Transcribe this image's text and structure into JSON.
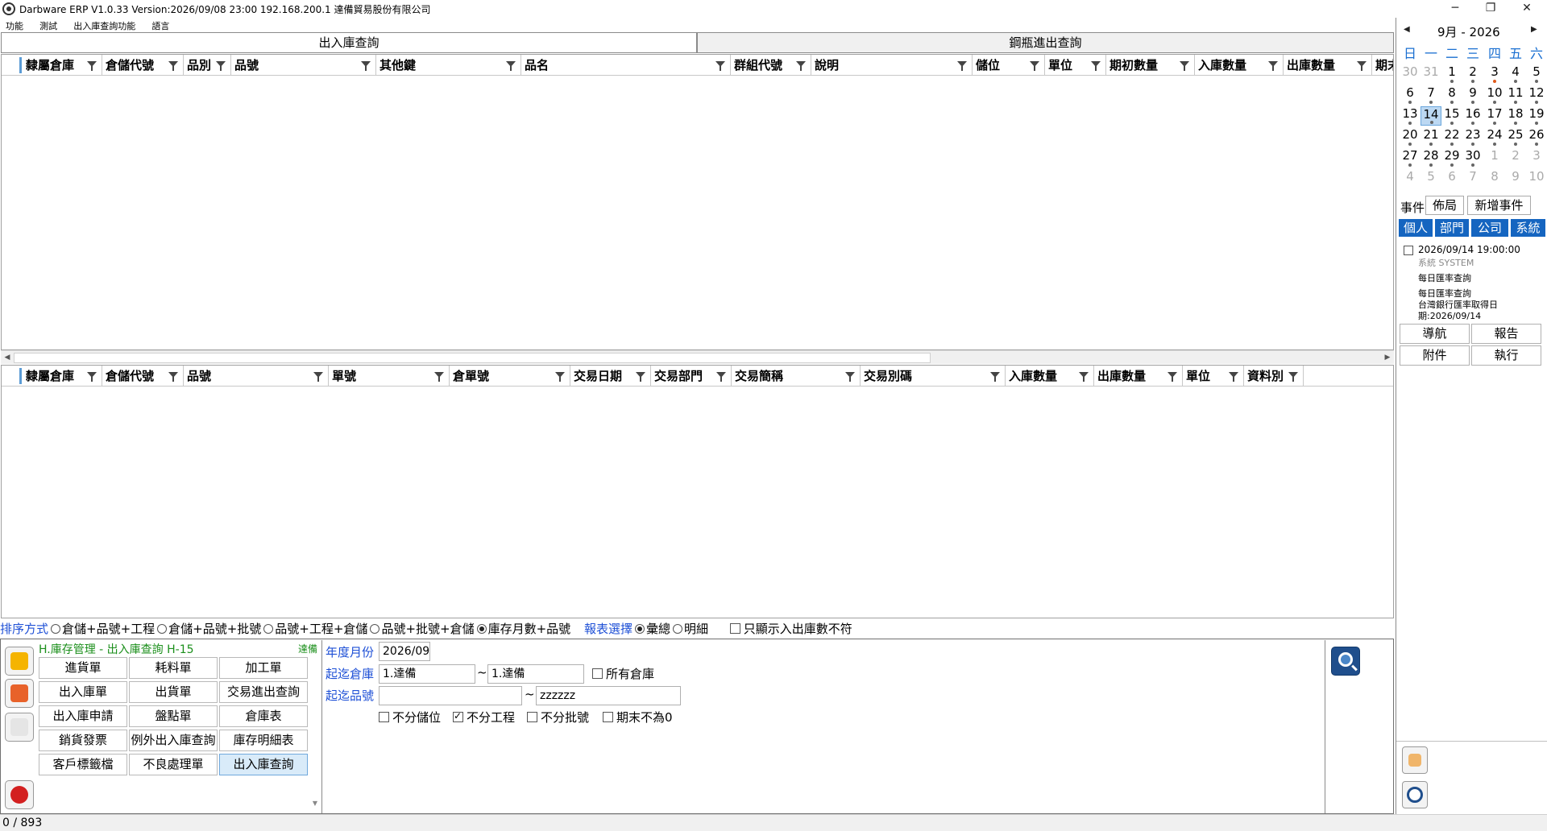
{
  "window": {
    "title": "Darbware ERP V1.0.33 Version:2026/09/08 23:00    192.168.200.1  達備貿易股份有限公司",
    "minimize": "─",
    "maximize": "❐",
    "close": "✕"
  },
  "menu": [
    "功能",
    "測試",
    "出入庫查詢功能",
    "語言"
  ],
  "tabs": {
    "inout": "出入庫查詢",
    "cylinder": "鋼瓶進出查詢"
  },
  "grid_top": {
    "columns": [
      "隸屬倉庫",
      "倉儲代號",
      "品別",
      "品號",
      "其他鍵",
      "品名",
      "群組代號",
      "說明",
      "儲位",
      "單位",
      "期初數量",
      "入庫數量",
      "出庫數量",
      "期末"
    ]
  },
  "grid_bottom": {
    "columns": [
      "隸屬倉庫",
      "倉儲代號",
      "品號",
      "單號",
      "倉單號",
      "交易日期",
      "交易部門",
      "交易簡稱",
      "交易別碼",
      "入庫數量",
      "出庫數量",
      "單位",
      "資料別"
    ]
  },
  "sort": {
    "label": "排序方式",
    "options": [
      "倉儲+品號+工程",
      "倉儲+品號+批號",
      "品號+工程+倉儲",
      "品號+批號+倉儲",
      "庫存月數+品號"
    ],
    "selected_index": 4,
    "report_label": "報表選擇",
    "report_options": [
      "彙總",
      "明細"
    ],
    "report_selected_index": 0,
    "only_mismatch": "只顯示入出庫數不符"
  },
  "module": {
    "title": "H.庫存管理 - 出入庫查詢  H-15",
    "tag": "達備",
    "buttons": [
      "進貨單",
      "耗料單",
      "加工單",
      "出入庫單",
      "出貨單",
      "交易進出查詢",
      "出入庫申請",
      "盤點單",
      "倉庫表",
      "銷貨發票",
      "例外出入庫查詢",
      "庫存明細表",
      "客戶標籤檔",
      "不良處理單",
      "出入庫查詢"
    ],
    "active_index": 14
  },
  "filters": {
    "period_label": "年度月份",
    "period_value": "2026/09",
    "warehouse_label": "起迄倉庫",
    "warehouse_from": "1.達備",
    "warehouse_to": "1.達備",
    "tilde": "~",
    "all_warehouses": "所有倉庫",
    "item_label": "起迄品號",
    "item_from": "",
    "item_to": "zzzzzz",
    "opt_no_location": "不分儲位",
    "opt_no_project": "不分工程",
    "opt_no_batch": "不分批號",
    "opt_end_nonzero": "期末不為0"
  },
  "status": {
    "text": "0  /  893"
  },
  "calendar": {
    "month": "9月",
    "dash": "-",
    "year": "2026",
    "prev": "◀",
    "next": "▶",
    "weekdays": [
      "日",
      "一",
      "二",
      "三",
      "四",
      "五",
      "六"
    ],
    "weeks": [
      [
        "30",
        "31",
        "1",
        "2",
        "3",
        "4",
        "5"
      ],
      [
        "6",
        "7",
        "8",
        "9",
        "10",
        "11",
        "12"
      ],
      [
        "13",
        "14",
        "15",
        "16",
        "17",
        "18",
        "19"
      ],
      [
        "20",
        "21",
        "22",
        "23",
        "24",
        "25",
        "26"
      ],
      [
        "27",
        "28",
        "29",
        "30",
        "1",
        "2",
        "3"
      ],
      [
        "4",
        "5",
        "6",
        "7",
        "8",
        "9",
        "10"
      ]
    ],
    "today": "14"
  },
  "events": {
    "label": "事件",
    "layout_button": "佈局",
    "add_button": "新增事件",
    "scopes": [
      "個人",
      "部門",
      "公司",
      "系統"
    ],
    "item": {
      "datetime": "2026/09/14 19:00:00",
      "source": "系統  SYSTEM",
      "line1": "每日匯率查詢",
      "line2": "每日匯率查詢",
      "line3": "台灣銀行匯率取得日",
      "line4": "期:2026/09/14"
    }
  },
  "nav": {
    "navigate": "導航",
    "report": "報告",
    "attachment": "附件",
    "execute": "執行"
  },
  "colors": {
    "accent_blue": "#1565c0",
    "label_blue": "#1d4fd6",
    "module_green": "#1b8f1b",
    "active_button": "#d9ebf9"
  }
}
